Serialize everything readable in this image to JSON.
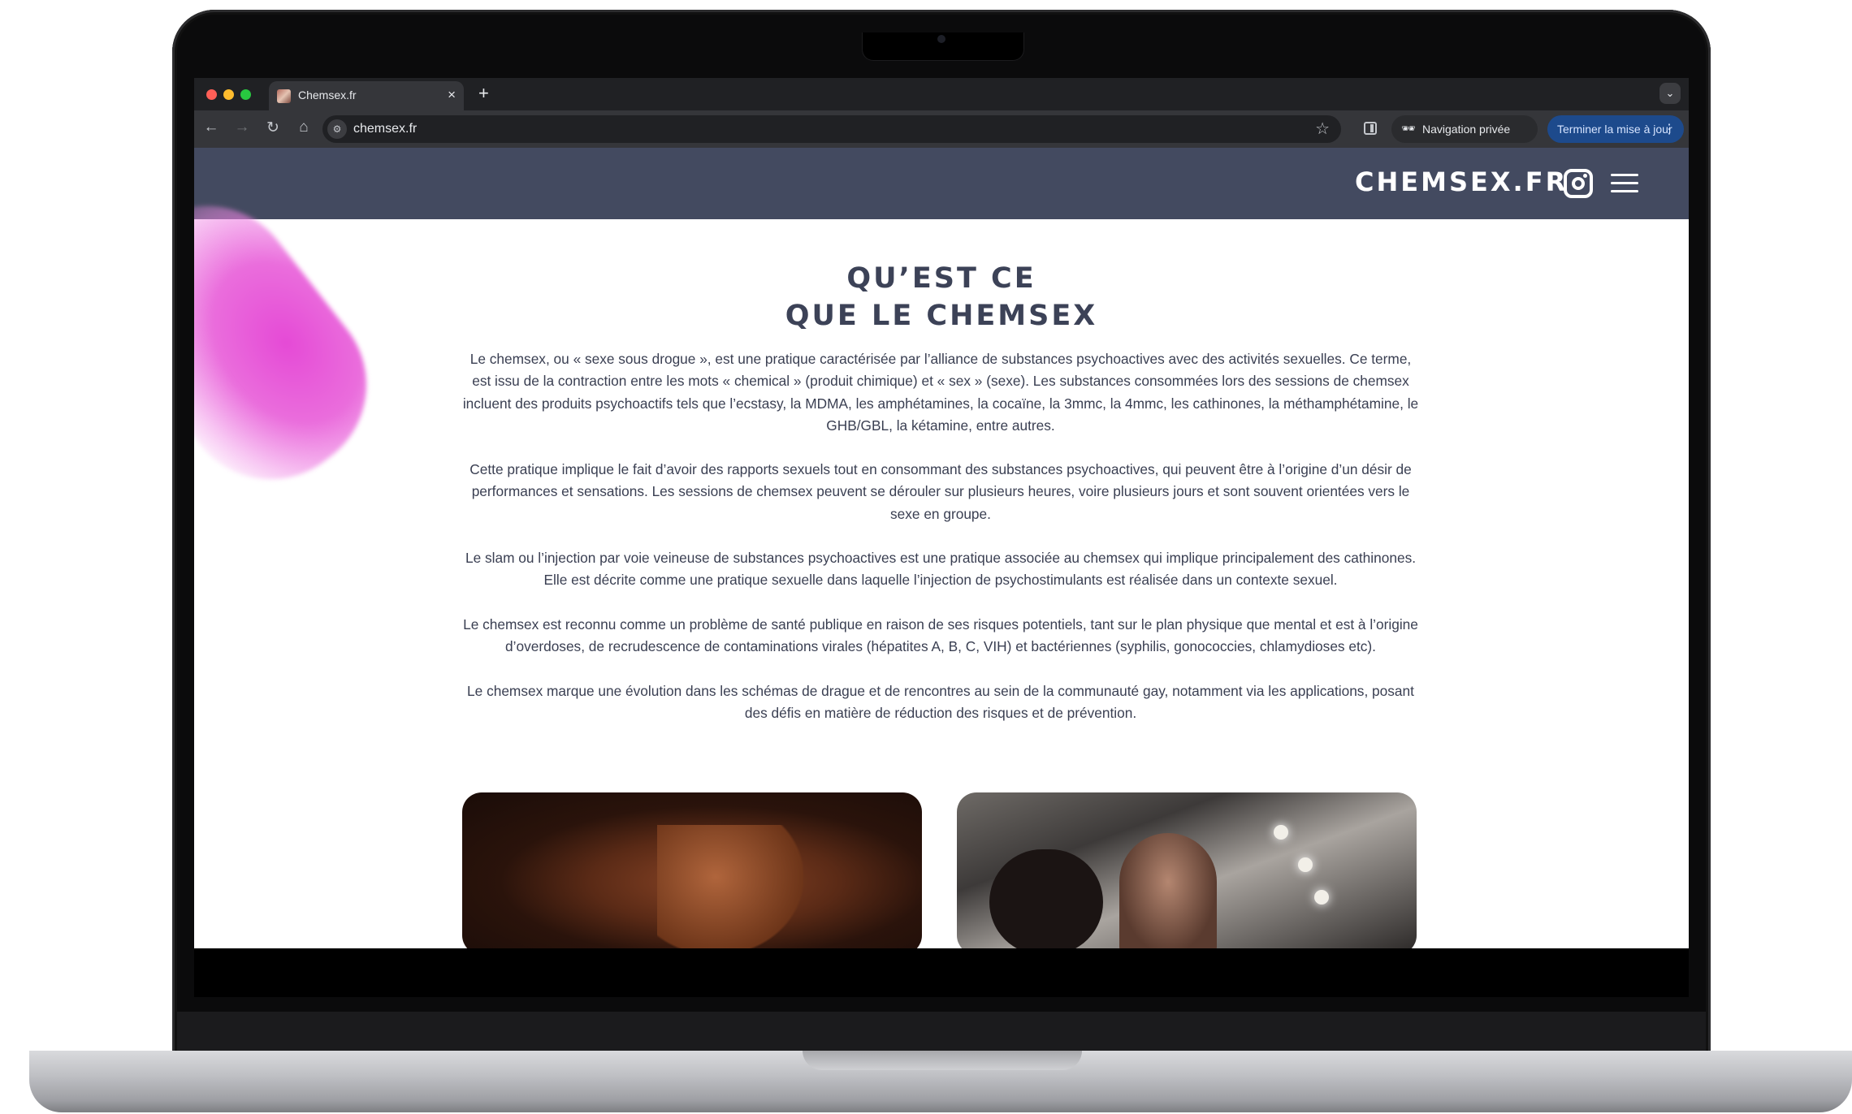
{
  "browser": {
    "tab_title": "Chemsex.fr",
    "url": "chemsex.fr",
    "incognito_label": "Navigation privée",
    "update_label": "Terminer la mise à jour"
  },
  "site": {
    "logo": "CHEMSEX.FR",
    "heading_line1": "QU’EST CE",
    "heading_line2": "QUE LE CHEMSEX",
    "paragraphs": [
      "Le chemsex, ou  « sexe sous drogue », est une pratique caractérisée par l’alliance de substances psychoactives avec des activités sexuelles. Ce terme, est issu de la contraction entre les mots « chemical » (produit chimique) et « sex » (sexe). Les substances consommées lors des sessions de chemsex incluent des produits psychoactifs tels que l’ecstasy, la MDMA, les amphétamines, la cocaïne, la 3mmc, la 4mmc, les cathinones, la méthamphétamine, le GHB/GBL, la kétamine, entre autres.",
      "Cette pratique implique le fait d’avoir des rapports sexuels tout en consommant des substances psychoactives, qui peuvent être à l’origine d’un désir de performances et sensations. Les sessions de chemsex peuvent se dérouler sur plusieurs heures, voire plusieurs jours et sont souvent orientées vers le sexe en groupe.",
      "Le slam ou l’injection par voie veineuse de substances psychoactives est une pratique associée au chemsex qui implique principalement des cathinones. Elle est décrite comme une pratique sexuelle dans laquelle l’injection de psychostimulants est réalisée dans un contexte sexuel.",
      "Le chemsex est reconnu comme un problème de santé publique en raison de ses risques potentiels, tant sur le plan physique que mental et est à l’origine d’overdoses, de recrudescence de contaminations virales (hépatites A, B, C, VIH) et bactériennes (syphilis, gonococcies, chlamydioses etc).",
      "Le chemsex marque une évolution dans les schémas de drague et de rencontres au sein de la communauté gay, notamment via les applications, posant des défis en matière de réduction des risques et de prévention."
    ]
  },
  "colors": {
    "header_bg": "#434a60",
    "heading": "#3c4257",
    "accent_blob": "#e54ad6",
    "update_button": "#1d4a8c"
  },
  "icons": [
    "back-arrow-icon",
    "forward-arrow-icon",
    "reload-icon",
    "home-icon",
    "site-info-icon",
    "star-icon",
    "side-panel-icon",
    "incognito-icon",
    "kebab-menu-icon",
    "instagram-icon",
    "hamburger-menu-icon"
  ]
}
